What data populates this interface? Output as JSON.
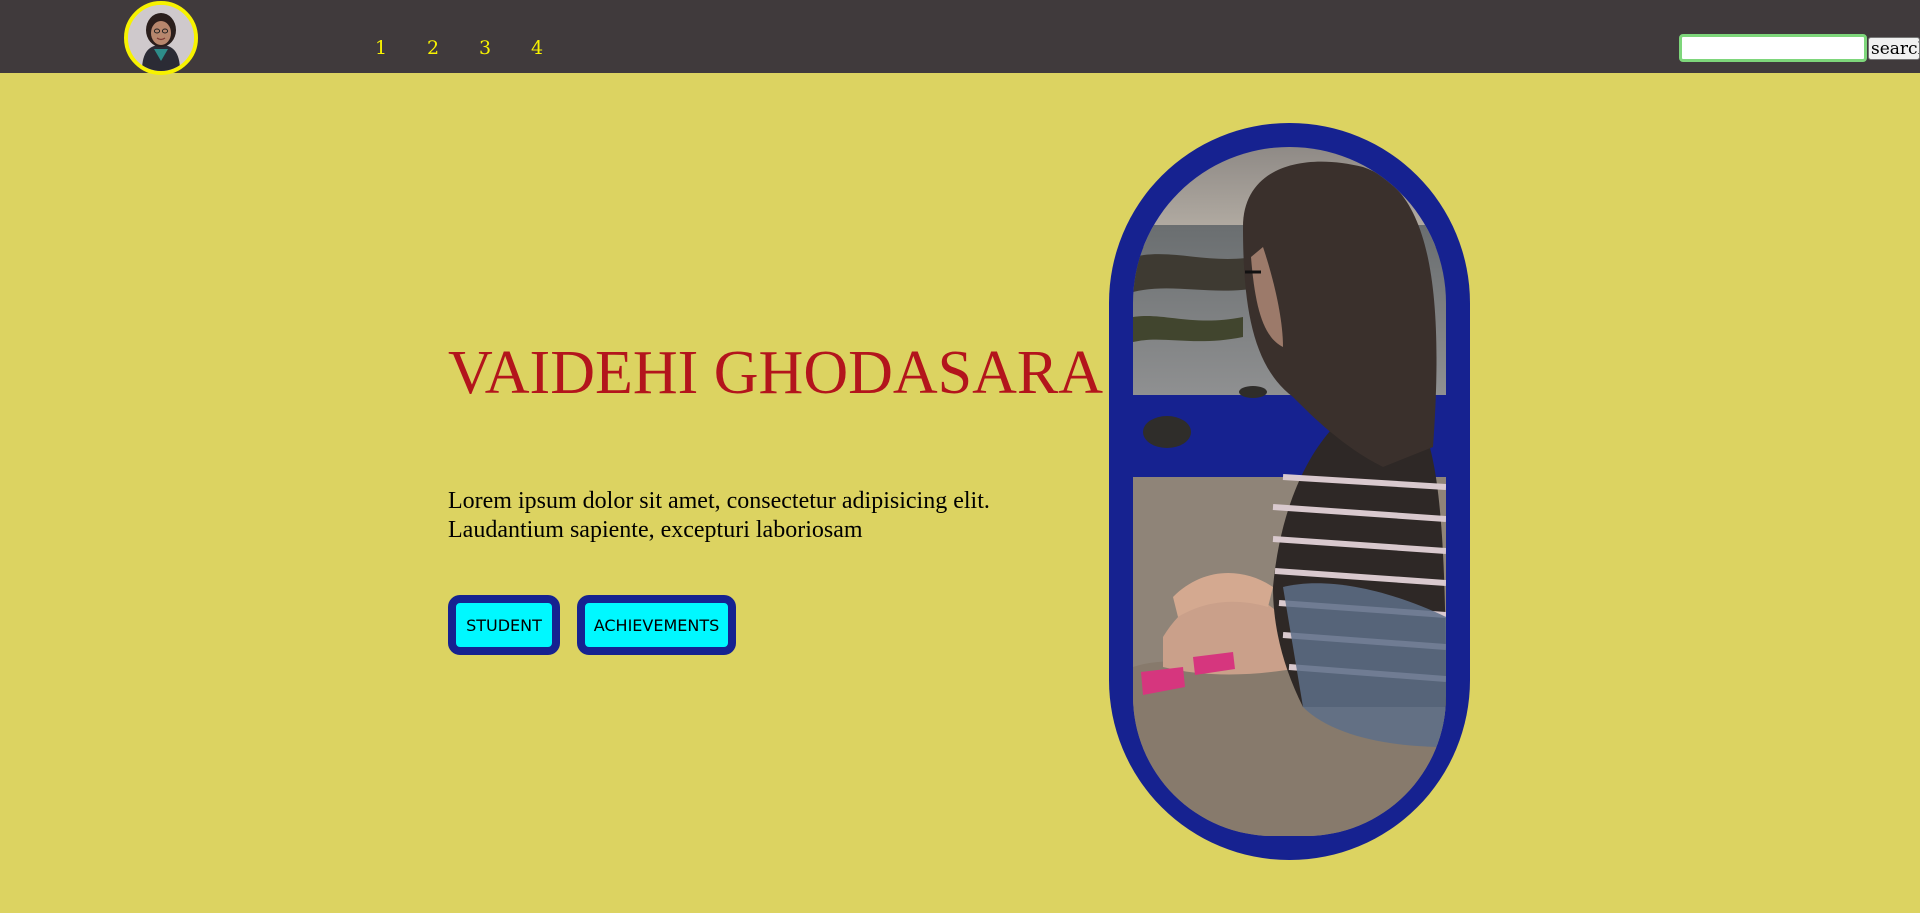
{
  "nav": {
    "links": [
      "1",
      "2",
      "3",
      "4"
    ],
    "search": {
      "value": "",
      "placeholder": "",
      "button_label": "search"
    }
  },
  "hero": {
    "title": "VAIDEHI GHODASARA",
    "description": "Lorem ipsum dolor sit amet, consectetur adipisicing elit. Laudantium sapiente, excepturi laboriosam",
    "buttons": {
      "student": "STUDENT",
      "achievements": "ACHIEVEMENTS"
    }
  },
  "colors": {
    "page_background": "#dcd361",
    "navbar": "#403a3c",
    "nav_link": "#f7f200",
    "title": "#b3151c",
    "accent_border": "#162290",
    "button_fill": "#00f8ff",
    "search_border": "#7ed67b"
  },
  "icons": {
    "logo": "profile-avatar-image",
    "hero_photo": "profile-photo-image"
  }
}
